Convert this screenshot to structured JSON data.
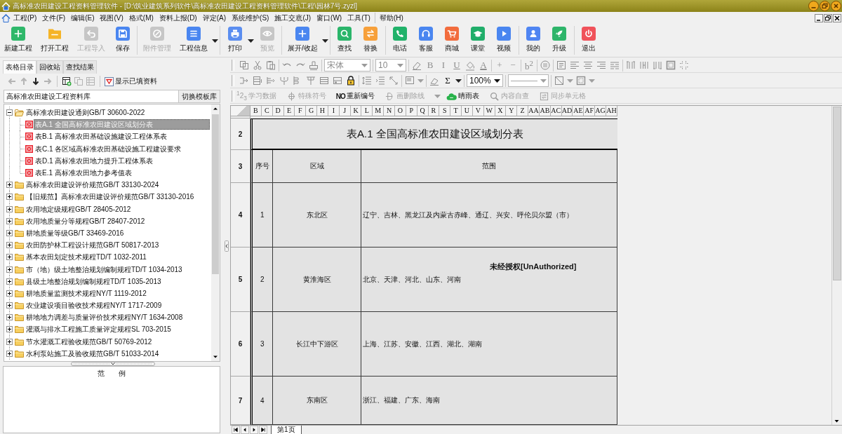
{
  "window": {
    "title": "高标准农田建设工程资料管理软件 - [D:\\筑业建筑系列软件\\高标准农田建设工程资料管理软件\\工程\\园林7号.zyzl]"
  },
  "menu": {
    "items": [
      "工程(P)",
      "文件(F)",
      "编辑(E)",
      "视图(V)",
      "格式(M)",
      "资料上报(D)",
      "评定(A)",
      "系统维护(S)",
      "施工交底(J)",
      "窗口(W)",
      "工具(T)"
    ],
    "help": "帮助(H)"
  },
  "toolbar": [
    [
      {
        "label": "新建工程",
        "color": "#2eb86a",
        "disabled": false
      },
      {
        "label": "打开工程",
        "color": "#f5b427",
        "disabled": false
      },
      {
        "label": "工程导入",
        "disabled": true
      },
      {
        "label": "保存",
        "color": "#4a86f0",
        "disabled": false
      }
    ],
    [
      {
        "label": "附件管理",
        "disabled": true
      },
      {
        "label": "工程信息",
        "color": "#4a86f0",
        "disabled": false,
        "has_menu": true
      }
    ],
    [
      {
        "label": "打印",
        "color": "#5b8ef0",
        "disabled": false,
        "has_menu": true
      },
      {
        "label": "预览",
        "disabled": true
      }
    ],
    [
      {
        "label": "展开/收起",
        "color": "#4a86f0",
        "disabled": false,
        "has_menu": true
      }
    ],
    [
      {
        "label": "查找",
        "color": "#2ab56a",
        "disabled": false
      },
      {
        "label": "替换",
        "color": "#f7a03a",
        "disabled": false
      }
    ],
    [
      {
        "label": "电话",
        "color": "#20b26a",
        "disabled": false
      },
      {
        "label": "客服",
        "color": "#4a86f0",
        "disabled": false
      },
      {
        "label": "商城",
        "color": "#f26c3d",
        "disabled": false
      },
      {
        "label": "课堂",
        "color": "#20ae6a",
        "disabled": false
      },
      {
        "label": "视频",
        "color": "#4a86f0",
        "disabled": false
      }
    ],
    [
      {
        "label": "我的",
        "color": "#4f85f2",
        "disabled": false
      },
      {
        "label": "升级",
        "color": "#2eb56a",
        "disabled": false
      }
    ],
    [
      {
        "label": "退出",
        "color": "#f0525a",
        "disabled": false
      }
    ]
  ],
  "left_panel": {
    "tabs": [
      {
        "label": "表格目录",
        "selected": true
      },
      {
        "label": "回收站",
        "selected": false
      },
      {
        "label": "查找结果",
        "selected": false
      }
    ],
    "tools": [
      [
        {
          "disabled": true
        },
        {
          "disabled": true
        },
        {
          "disabled": false
        },
        {
          "disabled": true
        }
      ],
      [
        {
          "disabled": false
        },
        {
          "disabled": true
        },
        {
          "disabled": true
        }
      ]
    ],
    "filter_button": "显示已填资料",
    "library_field": {
      "value": "高标准农田建设工程资料库"
    },
    "switch_button": "切换模板库",
    "tree": [
      {
        "label": "高标准农田建设通则GB/T 30600-2022",
        "expanded": true,
        "selected": false,
        "children": [
          {
            "label": "表A.1 全国高标准农田建设区域划分表",
            "selected": true
          },
          {
            "label": "表B.1 高标准农田基础设施建设工程体系表",
            "selected": false
          },
          {
            "label": "表C.1 各区域高标准农田基础设施工程建设要求",
            "selected": false
          },
          {
            "label": "表D.1 高标准农田地力提升工程体系表",
            "selected": false
          },
          {
            "label": "表E.1 高标准农田地力参考值表",
            "selected": false
          }
        ]
      },
      {
        "label": "高标准农田建设评价规范GB/T 33130-2024",
        "expanded": false,
        "selected": false
      },
      {
        "label": "【旧规范】高标准农田建设评价规范GB/T 33130-2016",
        "expanded": false,
        "selected": false
      },
      {
        "label": "农用地定级规程GB/T 28405-2012",
        "expanded": false,
        "selected": false
      },
      {
        "label": "农用地质量分等规程GB/T 28407-2012",
        "expanded": false,
        "selected": false
      },
      {
        "label": "耕地质量等级GB/T 33469-2016",
        "expanded": false,
        "selected": false
      },
      {
        "label": "农田防护林工程设计规范GB/T 50817-2013",
        "expanded": false,
        "selected": false
      },
      {
        "label": "基本农田划定技术规程TD/T 1032-2011",
        "expanded": false,
        "selected": false
      },
      {
        "label": "市（地）级土地整治规划编制规程TD/T 1034-2013",
        "expanded": false,
        "selected": false
      },
      {
        "label": "县级土地整治规划编制规程TD/T 1035-2013",
        "expanded": false,
        "selected": false
      },
      {
        "label": "耕地质量监测技术规程NY/T 1119-2012",
        "expanded": false,
        "selected": false
      },
      {
        "label": "农业建设项目验收技术规程NY/T 1717-2009",
        "expanded": false,
        "selected": false
      },
      {
        "label": "耕地地力调差与质量评价技术规程NY/T 1634-2008",
        "expanded": false,
        "selected": false
      },
      {
        "label": "灌溉与排水工程施工质量评定规程SL 703-2015",
        "expanded": false,
        "selected": false
      },
      {
        "label": "节水灌溉工程验收规范GB/T 50769-2012",
        "expanded": false,
        "selected": false
      },
      {
        "label": "水利泵站施工及验收规范GB/T 51033-2014",
        "expanded": false,
        "selected": false
      }
    ],
    "legend_title": "范　　例"
  },
  "format_bar": {
    "row_1": [
      [
        {
          "kind": "icon",
          "disabled": true
        },
        {
          "kind": "icon",
          "disabled": true
        },
        {
          "kind": "icon",
          "disabled": true
        }
      ],
      [
        {
          "kind": "icon",
          "disabled": true
        },
        {
          "kind": "icon",
          "disabled": true
        },
        {
          "kind": "icon",
          "disabled": true
        }
      ],
      [
        {
          "kind": "font_select",
          "value": "宋体",
          "disabled": true
        }
      ],
      [
        {
          "kind": "select",
          "value": "10",
          "disabled": true
        }
      ],
      [
        {
          "kind": "icon",
          "disabled": true
        },
        {
          "kind": "icon",
          "glyph": "B",
          "disabled": true
        },
        {
          "kind": "icon",
          "glyph": "I",
          "disabled": true
        },
        {
          "kind": "icon",
          "glyph": "U",
          "disabled": true
        },
        {
          "kind": "icon",
          "disabled": true
        },
        {
          "kind": "icon",
          "glyph": "A",
          "disabled": true
        }
      ],
      [
        {
          "kind": "icon",
          "glyph": "+",
          "disabled": true
        },
        {
          "kind": "icon",
          "glyph": "−",
          "disabled": true
        }
      ],
      [
        {
          "kind": "icon",
          "glyph": "b$^{2}$",
          "disabled": true
        }
      ],
      [
        {
          "kind": "icon",
          "disabled": true
        }
      ],
      [
        {
          "kind": "icon",
          "disabled": true
        },
        {
          "kind": "icon",
          "disabled": true
        },
        {
          "kind": "icon",
          "disabled": true
        },
        {
          "kind": "icon",
          "disabled": true
        },
        {
          "kind": "icon",
          "disabled": true
        }
      ],
      [
        {
          "kind": "icon",
          "disabled": true
        },
        {
          "kind": "icon",
          "disabled": true
        },
        {
          "kind": "icon",
          "disabled": true
        },
        {
          "kind": "icon",
          "disabled": true
        },
        {
          "kind": "icon",
          "disabled": true
        }
      ]
    ],
    "row_2": [
      [
        {
          "kind": "icon",
          "disabled": true
        },
        {
          "kind": "icon",
          "disabled": true
        },
        {
          "kind": "icon",
          "disabled": true
        },
        {
          "kind": "icon",
          "disabled": true
        },
        {
          "kind": "icon",
          "disabled": true
        },
        {
          "kind": "icon",
          "disabled": true
        },
        {
          "kind": "icon",
          "disabled": true
        },
        {
          "kind": "icon",
          "disabled": true
        },
        {
          "kind": "icon",
          "disabled": false
        }
      ],
      [
        {
          "kind": "icon",
          "disabled": true
        },
        {
          "kind": "icon",
          "disabled": true
        },
        {
          "kind": "icon",
          "disabled": true
        }
      ],
      [
        {
          "kind": "icon",
          "disabled": true,
          "has_menu": true
        }
      ],
      [
        {
          "kind": "icon",
          "disabled": true
        },
        {
          "kind": "icon",
          "glyph": "Σ",
          "disabled": false,
          "has_menu": true
        }
      ],
      [
        {
          "kind": "select",
          "value": "100%",
          "disabled": false
        }
      ],
      [
        {
          "kind": "line_select",
          "disabled": true
        }
      ],
      [
        {
          "kind": "icon",
          "disabled": true,
          "has_menu": true
        },
        {
          "kind": "icon",
          "disabled": true,
          "has_menu": true
        }
      ]
    ],
    "quick_tools": [
      {
        "glyph": "$^{1}$2$_{3}$",
        "label": "学习数据",
        "disabled": true
      },
      {
        "label": "特殊符号",
        "disabled": true
      },
      {
        "glyph": "NO",
        "label": "重新编号",
        "disabled": false
      },
      {
        "label": "画删除线",
        "disabled": true,
        "has_menu": true
      },
      {
        "label": "晴雨表",
        "disabled": false
      },
      {
        "label": "内容自查",
        "disabled": true
      },
      {
        "label": "同步单元格",
        "disabled": true
      }
    ]
  },
  "sheet": {
    "columns": [
      "B",
      "C",
      "D",
      "E",
      "F",
      "G",
      "H",
      "I",
      "J",
      "K",
      "L",
      "M",
      "N",
      "O",
      "P",
      "Q",
      "R",
      "S",
      "T",
      "U",
      "V",
      "W",
      "X",
      "Y",
      "Z",
      "AA",
      "AB",
      "AC",
      "AD",
      "AE",
      "AF",
      "AG",
      "AH"
    ],
    "title_row": {
      "number": "2",
      "text": "表A.1 全国高标准农田建设区域划分表"
    },
    "rows": [
      {
        "number": "3",
        "kind": "header",
        "cells": [
          "序号",
          "区域",
          "范围"
        ]
      },
      {
        "number": "4",
        "kind": "data",
        "cells": [
          "1",
          "东北区",
          "辽宁、吉林、黑龙江及内蒙古赤峰、通辽、兴安、呼伦贝尔盟（市）"
        ]
      },
      {
        "number": "5",
        "kind": "data",
        "cells": [
          "2",
          "黄淮海区",
          "北京、天津、河北、山东、河南"
        ]
      },
      {
        "number": "6",
        "kind": "data",
        "cells": [
          "3",
          "长江中下游区",
          "上海、江苏、安徽、江西、湖北、湖南"
        ]
      },
      {
        "number": "7",
        "kind": "data",
        "cells": [
          "4",
          "东南区",
          "浙江、福建、广东、海南"
        ]
      }
    ],
    "notice": "未经授权[UnAuthorized]",
    "tabs": [
      {
        "label": "第1页",
        "selected": true
      }
    ]
  }
}
